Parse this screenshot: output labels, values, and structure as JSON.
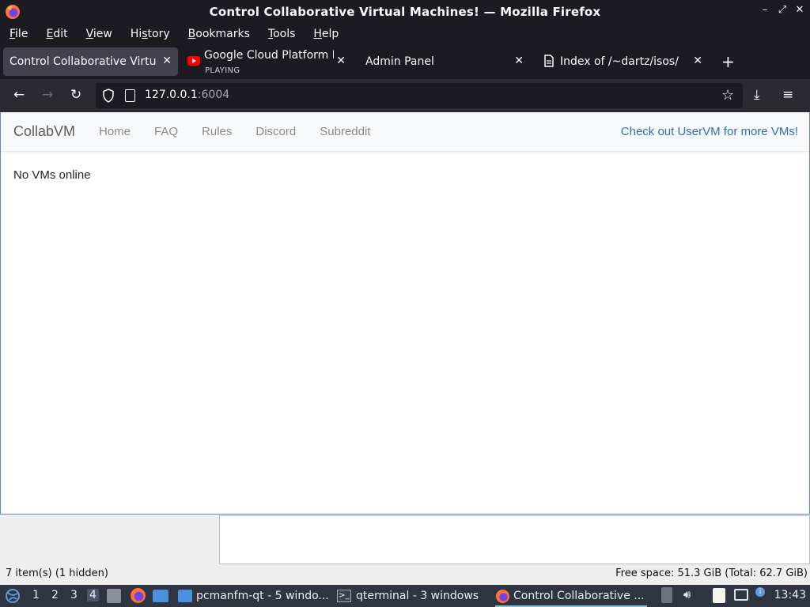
{
  "window": {
    "title": "Control Collaborative Virtual Machines! — Mozilla Firefox"
  },
  "menubar": {
    "items": [
      {
        "label_u": "F",
        "label_rest": "ile"
      },
      {
        "label_u": "E",
        "label_rest": "dit"
      },
      {
        "label_u": "V",
        "label_rest": "iew"
      },
      {
        "label_pre": "Hi",
        "label_u": "s",
        "label_rest": "tory"
      },
      {
        "label_u": "B",
        "label_rest": "ookmarks"
      },
      {
        "label_u": "T",
        "label_rest": "ools"
      },
      {
        "label_u": "H",
        "label_rest": "elp"
      }
    ]
  },
  "tabs": [
    {
      "label": "Control Collaborative Virtual Machines!",
      "active": true
    },
    {
      "label": "Google Cloud Platform Fundamentals",
      "sub": "PLAYING",
      "icon": "youtube-icon"
    },
    {
      "label": "Admin Panel"
    },
    {
      "label": "Index of /~dartz/isos/",
      "icon": "page-icon"
    }
  ],
  "urlbar": {
    "host": "127.0.0.1",
    "port": ":6004"
  },
  "site": {
    "brand": "CollabVM",
    "nav": [
      "Home",
      "FAQ",
      "Rules",
      "Discord",
      "Subreddit"
    ],
    "promo": "Check out UserVM for more VMs!",
    "status": "No VMs online"
  },
  "filemanager": {
    "status_left": "7 item(s) (1 hidden)",
    "status_right": "Free space: 51.3 GiB (Total: 62.7 GiB)"
  },
  "taskbar": {
    "desktops": [
      "1",
      "2",
      "3",
      "4"
    ],
    "current_desktop": "4",
    "windows": [
      {
        "label": "pcmanfm-qt - 5 windo..."
      },
      {
        "label": "qterminal - 3 windows"
      },
      {
        "label": "Control Collaborative ...",
        "active": true
      }
    ],
    "clock": "13:43"
  },
  "colors": {
    "accent": "#2a72b8",
    "active_tab": "#42414d",
    "chrome": "#1c1b22"
  }
}
